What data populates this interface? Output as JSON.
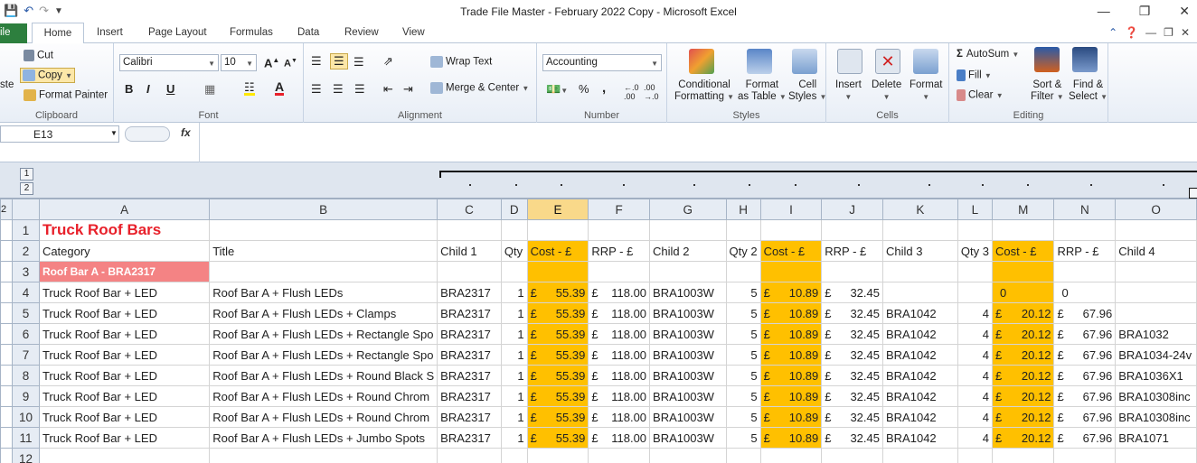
{
  "window": {
    "title": "Trade File Master - February 2022 Copy  -  Microsoft Excel"
  },
  "tabs": [
    "ile",
    "Home",
    "Insert",
    "Page Layout",
    "Formulas",
    "Data",
    "Review",
    "View"
  ],
  "clipboard": {
    "cut": "Cut",
    "copy": "Copy",
    "format_painter": "Format Painter",
    "paste": "ste",
    "label": "Clipboard"
  },
  "font": {
    "name": "Calibri",
    "size": "10",
    "bold": "B",
    "italic": "I",
    "underline": "U",
    "label": "Font"
  },
  "alignment": {
    "wrap": "Wrap Text",
    "merge": "Merge & Center",
    "label": "Alignment"
  },
  "number": {
    "format": "Accounting",
    "percent": "%",
    "comma": ",",
    "label": "Number"
  },
  "styles": {
    "conditional": "Conditional",
    "conditional2": "Formatting",
    "format_as": "Format",
    "format_as2": "as Table",
    "cell": "Cell",
    "cell2": "Styles",
    "label": "Styles"
  },
  "cells": {
    "insert": "Insert",
    "delete": "Delete",
    "format": "Format",
    "label": "Cells"
  },
  "editing": {
    "autosum": "AutoSum",
    "fill": "Fill",
    "clear": "Clear",
    "sort": "Sort &",
    "sort2": "Filter",
    "find": "Find &",
    "find2": "Select",
    "label": "Editing"
  },
  "formula_bar": {
    "name_box": "E13",
    "fx": "fx"
  },
  "outline": {
    "level1": "1",
    "level2": "2",
    "row_level": "2"
  },
  "columns": [
    "A",
    "B",
    "C",
    "D",
    "E",
    "F",
    "G",
    "H",
    "I",
    "J",
    "K",
    "L",
    "M",
    "N",
    "O"
  ],
  "rows": [
    {
      "n": "1",
      "A": "Truck Roof Bars"
    },
    {
      "n": "2",
      "A": "Category",
      "B": "Title",
      "C": "Child 1",
      "D": "Qty",
      "E": "Cost - £",
      "F": "RRP - £",
      "G": "Child 2",
      "H": "Qty 2",
      "I": "Cost - £",
      "J": "RRP - £",
      "K": "Child 3",
      "L": "Qty 3",
      "M": "Cost - £",
      "N": "RRP - £",
      "O": "Child 4"
    },
    {
      "n": "3",
      "A": "Roof Bar A - BRA2317"
    },
    {
      "n": "4",
      "A": "Truck Roof Bar + LED",
      "B": "Roof Bar A + Flush LEDs",
      "C": "BRA2317",
      "D": "1",
      "E": "55.39",
      "F": "118.00",
      "G": "BRA1003W",
      "H": "5",
      "I": "10.89",
      "J": "32.45",
      "K": "",
      "L": "",
      "M": "0",
      "N": "0",
      "O": ""
    },
    {
      "n": "5",
      "A": "Truck Roof Bar + LED",
      "B": "Roof Bar A + Flush LEDs + Clamps",
      "C": "BRA2317",
      "D": "1",
      "E": "55.39",
      "F": "118.00",
      "G": "BRA1003W",
      "H": "5",
      "I": "10.89",
      "J": "32.45",
      "K": "BRA1042",
      "L": "4",
      "M": "20.12",
      "N": "67.96",
      "O": ""
    },
    {
      "n": "6",
      "A": "Truck Roof Bar + LED",
      "B": "Roof Bar A + Flush LEDs + Rectangle Spo",
      "C": "BRA2317",
      "D": "1",
      "E": "55.39",
      "F": "118.00",
      "G": "BRA1003W",
      "H": "5",
      "I": "10.89",
      "J": "32.45",
      "K": "BRA1042",
      "L": "4",
      "M": "20.12",
      "N": "67.96",
      "O": "BRA1032"
    },
    {
      "n": "7",
      "A": "Truck Roof Bar + LED",
      "B": "Roof Bar A + Flush LEDs + Rectangle Spo",
      "C": "BRA2317",
      "D": "1",
      "E": "55.39",
      "F": "118.00",
      "G": "BRA1003W",
      "H": "5",
      "I": "10.89",
      "J": "32.45",
      "K": "BRA1042",
      "L": "4",
      "M": "20.12",
      "N": "67.96",
      "O": "BRA1034-24v"
    },
    {
      "n": "8",
      "A": "Truck Roof Bar + LED",
      "B": "Roof Bar A + Flush LEDs + Round Black S",
      "C": "BRA2317",
      "D": "1",
      "E": "55.39",
      "F": "118.00",
      "G": "BRA1003W",
      "H": "5",
      "I": "10.89",
      "J": "32.45",
      "K": "BRA1042",
      "L": "4",
      "M": "20.12",
      "N": "67.96",
      "O": "BRA1036X1"
    },
    {
      "n": "9",
      "A": "Truck Roof Bar + LED",
      "B": "Roof Bar A + Flush LEDs + Round Chrom",
      "C": "BRA2317",
      "D": "1",
      "E": "55.39",
      "F": "118.00",
      "G": "BRA1003W",
      "H": "5",
      "I": "10.89",
      "J": "32.45",
      "K": "BRA1042",
      "L": "4",
      "M": "20.12",
      "N": "67.96",
      "O": "BRA10308inc"
    },
    {
      "n": "10",
      "A": "Truck Roof Bar + LED",
      "B": "Roof Bar A + Flush LEDs + Round Chrom",
      "C": "BRA2317",
      "D": "1",
      "E": "55.39",
      "F": "118.00",
      "G": "BRA1003W",
      "H": "5",
      "I": "10.89",
      "J": "32.45",
      "K": "BRA1042",
      "L": "4",
      "M": "20.12",
      "N": "67.96",
      "O": "BRA10308inc"
    },
    {
      "n": "11",
      "A": "Truck Roof Bar + LED",
      "B": "Roof Bar A + Flush LEDs + Jumbo Spots",
      "C": "BRA2317",
      "D": "1",
      "E": "55.39",
      "F": "118.00",
      "G": "BRA1003W",
      "H": "5",
      "I": "10.89",
      "J": "32.45",
      "K": "BRA1042",
      "L": "4",
      "M": "20.12",
      "N": "67.96",
      "O": "BRA1071"
    },
    {
      "n": "12"
    }
  ],
  "currency_symbol": "£",
  "colors": {
    "highlight": "#ffc000",
    "title_red": "#e8202a",
    "pink": "#f48384"
  }
}
